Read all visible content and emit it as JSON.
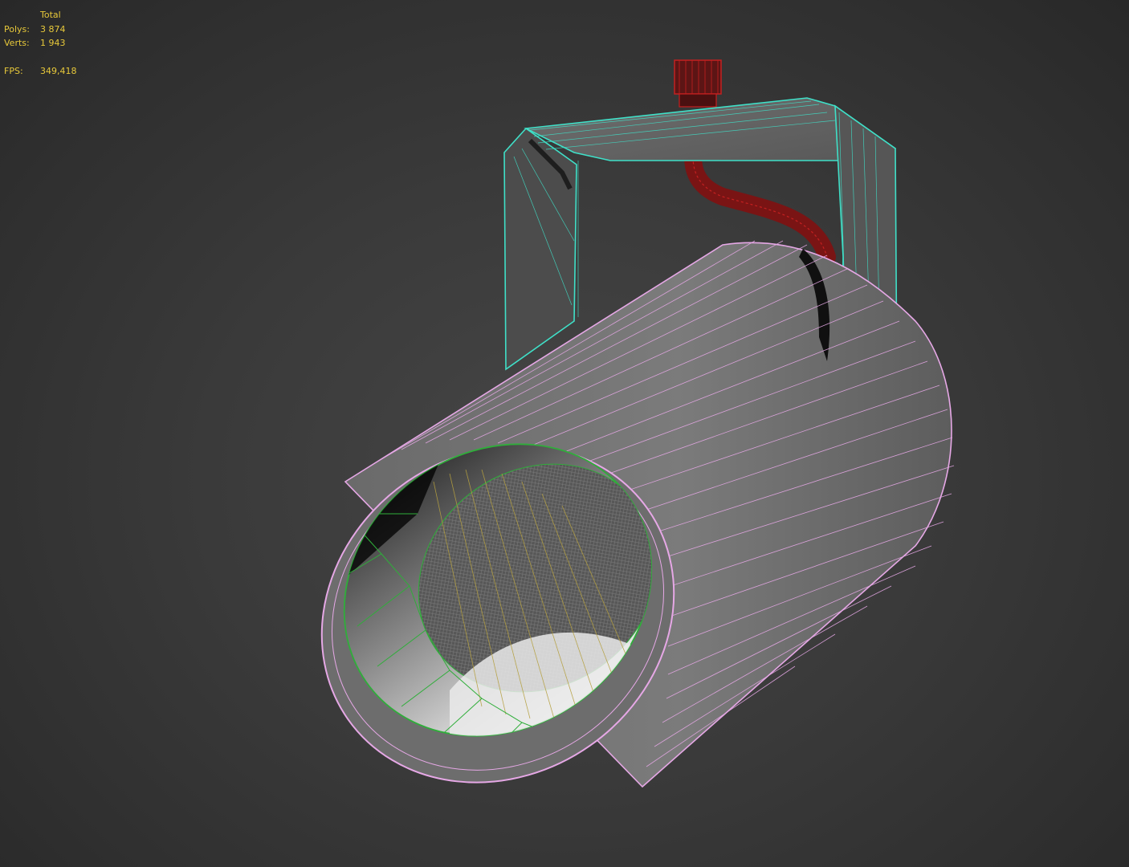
{
  "stats": {
    "header": "Total",
    "polys_label": "Polys:",
    "polys_value": "3 874",
    "verts_label": "Verts:",
    "verts_value": "1 943",
    "fps_label": "FPS:",
    "fps_value": "349,418"
  },
  "colors": {
    "background": "#3a3a3a",
    "stats_text": "#e8c93a",
    "housing_wire": "#e6a8e6",
    "bracket_wire": "#3fe0c8",
    "connector_wire": "#c42020",
    "reflector_wire": "#2fae3a",
    "lens_wire": "#b5a040"
  },
  "scene": {
    "object": "spotlight-wireframe-model"
  }
}
